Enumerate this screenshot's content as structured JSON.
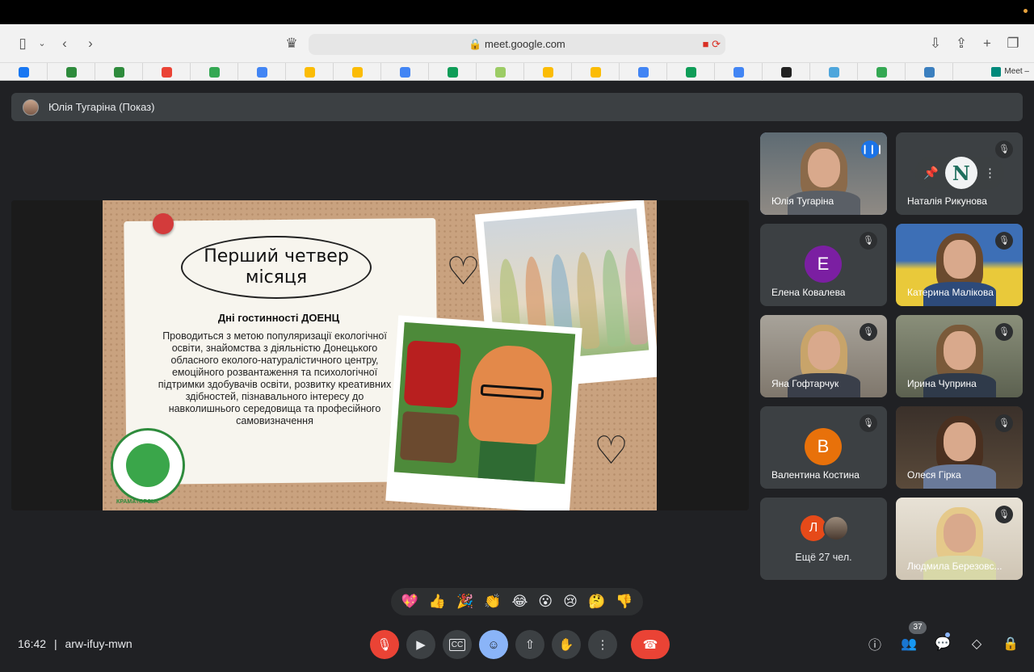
{
  "browser": {
    "url": "meet.google.com",
    "bookmark_tab_label": "Meet –",
    "bookmark_colors": [
      "#1877f2",
      "#2e8b3c",
      "#2e8b3c",
      "#ea4335",
      "#34a853",
      "#4285f4",
      "#fbbc05",
      "#fbbc05",
      "#4285f4",
      "#0f9d58",
      "#9ccc65",
      "#fbbc05",
      "#fbbc05",
      "#4285f4",
      "#0f9d58",
      "#4285f4",
      "#222222",
      "#4ea6dc",
      "#34a853",
      "#3b7fbf"
    ]
  },
  "presenter": {
    "label": "Юлія Тугаріна (Показ)"
  },
  "slide": {
    "title_line1": "Перший четвер",
    "title_line2": "місяця",
    "subtitle": "Дні гостинності ДОЕНЦ",
    "body": "Проводиться з метою популяризації екологічної освіти, знайомства з діяльністю Донецького обласного еколого-натуралістичного центру, емоційного розвантаження та психологічної підтримки здобувачів освіти, розвитку креативних здібностей, пізнавального інтересу до навколишнього середовища та професійного самовизначення",
    "logo_text": "КРАМАТОРСЬК"
  },
  "participants": [
    {
      "name": "Юлія Тугаріна",
      "active": true
    },
    {
      "name": "Наталія Рикунова",
      "initial": "N"
    },
    {
      "name": "Елена Ковалева",
      "initial": "Е",
      "color": "#7b1fa2"
    },
    {
      "name": "Катерина Малікова"
    },
    {
      "name": "Яна Гофтарчук"
    },
    {
      "name": "Ирина Чуприна"
    },
    {
      "name": "Валентина Костина",
      "initial": "В",
      "color": "#e8710a"
    },
    {
      "name": "Олеся Гірка"
    },
    {
      "name": "Ещё 27 чел.",
      "initial": "Л",
      "color": "#e64a19"
    },
    {
      "name": "Людмила Березовс..."
    }
  ],
  "reactions": [
    "💖",
    "👍",
    "🎉",
    "👏",
    "😂",
    "😮",
    "😢",
    "🤔",
    "👎"
  ],
  "footer": {
    "time": "16:42",
    "separator": "|",
    "meeting_code": "arw-ifuy-mwn",
    "participant_count": "37"
  }
}
